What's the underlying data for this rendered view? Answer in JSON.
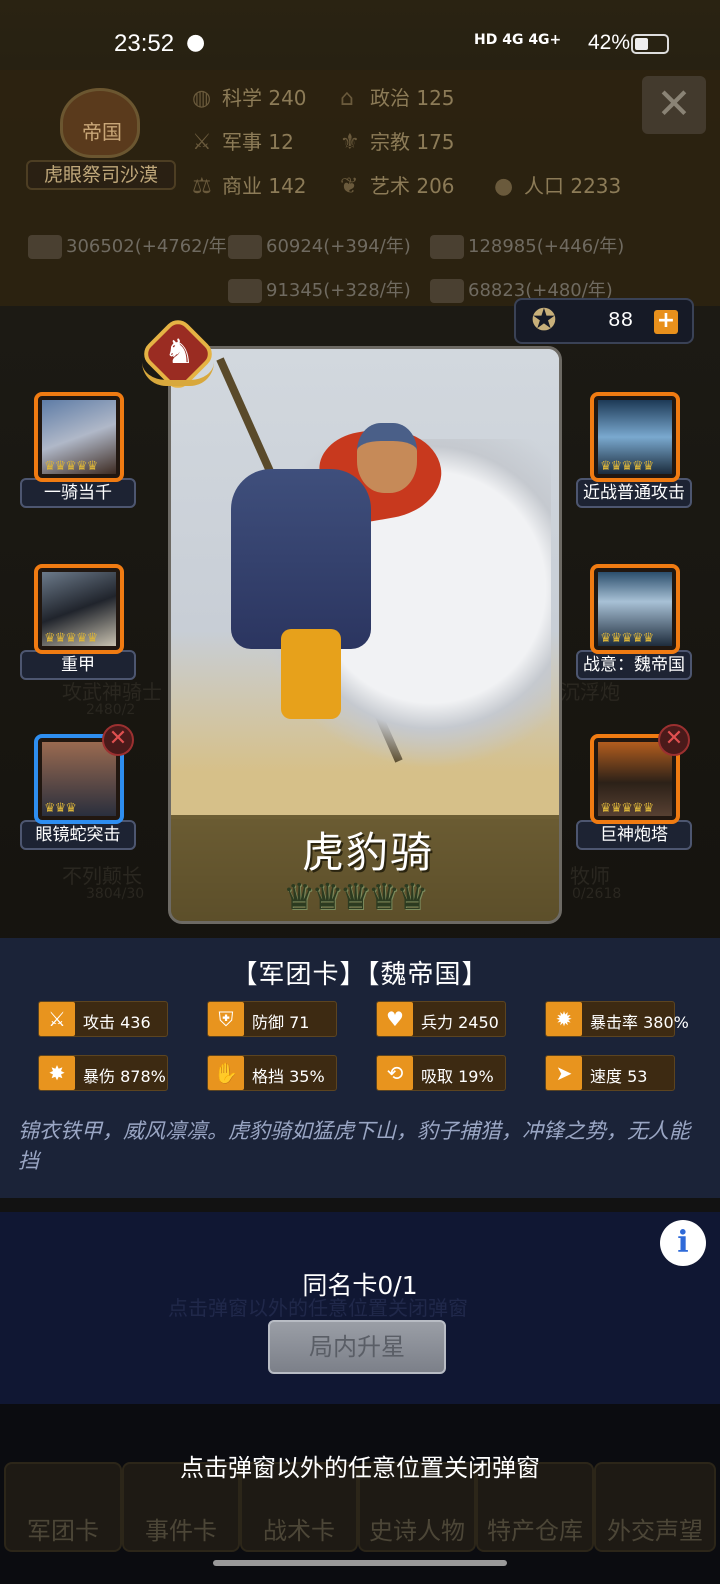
{
  "status_bar": {
    "time": "23:52",
    "qq_icon": "qq-penguin-icon",
    "network": "HD 4G 4G+",
    "battery_pct": "42%",
    "battery_level": 0.42
  },
  "kingdom": {
    "empire_label": "帝国",
    "ruler_name": "虎眼祭司沙漠"
  },
  "top_stats": [
    {
      "icon": "planet-icon",
      "label": "科学 240"
    },
    {
      "icon": "temple-icon",
      "label": "政治 125"
    },
    {
      "icon": "crossed-swords-icon",
      "label": "军事 12"
    },
    {
      "icon": "fleur-icon",
      "label": "宗教 175"
    },
    {
      "icon": "scales-icon",
      "label": "商业 142"
    },
    {
      "icon": "laurel-icon",
      "label": "艺术 206"
    },
    {
      "icon": "person-icon",
      "label": "人口 2233"
    }
  ],
  "resources": [
    {
      "icon": "gold-icon",
      "label": "306502(+4762/年)"
    },
    {
      "icon": "wood-icon",
      "label": "60924(+394/年)"
    },
    {
      "icon": "iron-icon",
      "label": "128985(+446/年)"
    },
    {
      "icon": "stone-icon",
      "label": "91345(+328/年)"
    },
    {
      "icon": "meat-icon",
      "label": "68823(+480/年)"
    }
  ],
  "medal": {
    "icon": "medal-icon",
    "count": "88",
    "plus": "+"
  },
  "skills_left": [
    {
      "label": "一骑当千",
      "crowns": "♛♛♛♛♛",
      "removable": false
    },
    {
      "label": "重甲",
      "crowns": "♛♛♛♛♛",
      "removable": false
    },
    {
      "label": "眼镜蛇突击",
      "crowns": "♛♛♛",
      "removable": true
    }
  ],
  "skills_right": [
    {
      "label": "近战普通攻击",
      "crowns": "♛♛♛♛♛",
      "removable": false
    },
    {
      "label": "战意：魏帝国",
      "crowns": "♛♛♛♛♛",
      "removable": false
    },
    {
      "label": "巨神炮塔",
      "crowns": "♛♛♛♛♛",
      "removable": true
    }
  ],
  "card": {
    "name": "虎豹骑",
    "stars": "♛♛♛♛♛",
    "badge_icon": "knight-badge-icon"
  },
  "card_types": "【军团卡】【魏帝国】",
  "stats": [
    {
      "icon": "sword-icon",
      "glyph": "⚔",
      "label": "攻击",
      "value": "436"
    },
    {
      "icon": "shield-icon",
      "glyph": "⛨",
      "label": "防御",
      "value": "71"
    },
    {
      "icon": "heart-icon",
      "glyph": "♥",
      "label": "兵力",
      "value": "2450"
    },
    {
      "icon": "crit-icon",
      "glyph": "✹",
      "label": "暴击率",
      "value": "380%"
    },
    {
      "icon": "crit-damage-icon",
      "glyph": "✸",
      "label": "暴伤",
      "value": "878%"
    },
    {
      "icon": "block-icon",
      "glyph": "✋",
      "label": "格挡",
      "value": "35%"
    },
    {
      "icon": "lifesteal-icon",
      "glyph": "⟲",
      "label": "吸取",
      "value": "19%"
    },
    {
      "icon": "speed-icon",
      "glyph": "➤",
      "label": "速度",
      "value": "53"
    }
  ],
  "description": "锦衣铁甲，威风凛凛。虎豹骑如猛虎下山，豹子捕猎，冲锋之势，无人能挡",
  "duplicate_cards": "同名卡0/1",
  "upstar_button": "局内升星",
  "info_button": "i",
  "close_hint": "点击弹窗以外的任意位置关闭弹窗",
  "bottom_nav": [
    "军团卡",
    "事件卡",
    "战术卡",
    "史诗人物",
    "特产仓库",
    "外交声望"
  ],
  "bg_ghost": {
    "bar1": "2480/2",
    "bar2": "3804/30",
    "bar3": "0/2618",
    "unit1": "攻武神骑士",
    "unit2": "不列颠长",
    "unit3": "牧师",
    "unit4": "沉浮炮"
  },
  "colors": {
    "accent_orange": "#e8941e",
    "legendary_frame": "#f07b12",
    "rare_frame": "#2e8ef0",
    "panel_blue": "#1b2338"
  }
}
